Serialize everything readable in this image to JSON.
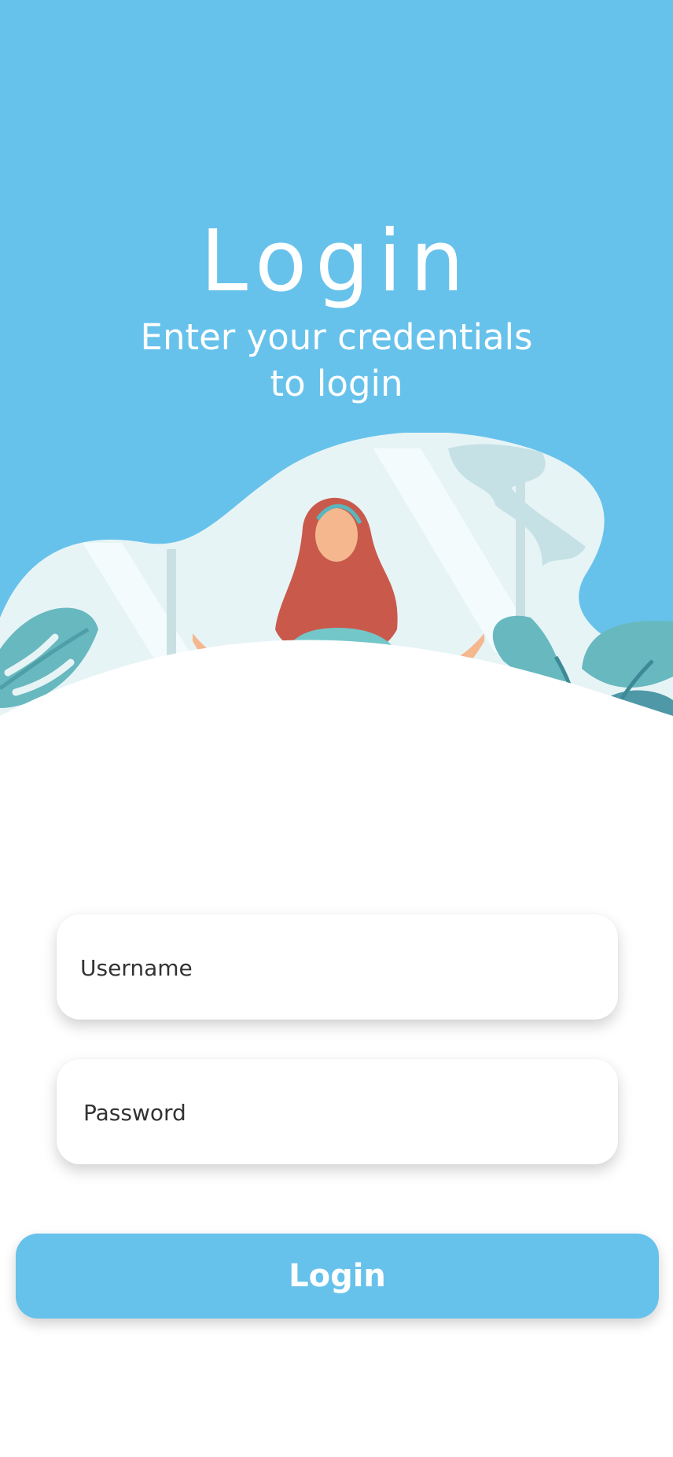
{
  "header": {
    "title": "Login",
    "subtitle": "Enter your credentials to login"
  },
  "form": {
    "username_placeholder": "Username",
    "password_placeholder": "Password",
    "submit_label": "Login"
  },
  "illustration": {
    "icon": "meditation-illustration"
  },
  "colors": {
    "accent": "#67c2eb",
    "text": "#333333",
    "white": "#ffffff",
    "leaf": "#68b8bf",
    "pot": "#f2a44b",
    "hair": "#c95a4b",
    "skin": "#f4b78e",
    "shirt": "#73c7c9"
  }
}
